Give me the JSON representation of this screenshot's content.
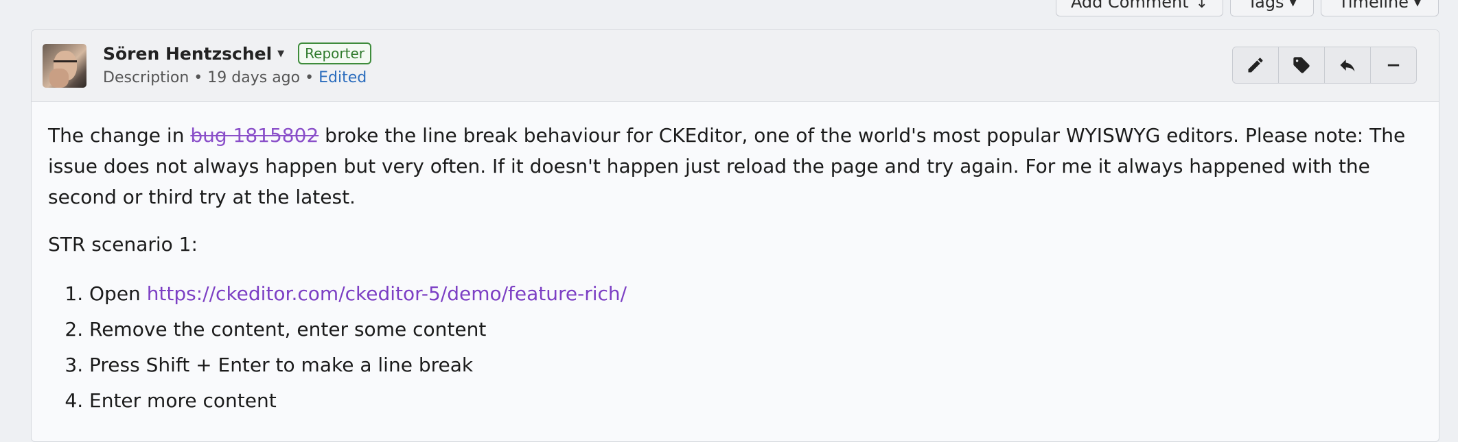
{
  "toolbar": {
    "add_comment_label": "Add Comment",
    "tags_label": "Tags",
    "timeline_label": "Timeline"
  },
  "comment": {
    "author": "Sören Hentzschel",
    "role_badge": "Reporter",
    "meta_type": "Description",
    "meta_time": "19 days ago",
    "meta_edited": "Edited",
    "actions": [
      "edit-icon",
      "tag-icon",
      "reply-icon",
      "collapse-icon"
    ],
    "body": {
      "intro_prefix": "The change in ",
      "bug_ref": "bug 1815802",
      "intro_suffix": " broke the line break behaviour for CKEditor, one of the world's most popular WYISWYG editors. Please note: The issue does not always happen but very often. If it doesn't happen just reload the page and try again. For me it always happened with the second or third try at the latest.",
      "scenario_heading": "STR scenario 1:",
      "step1_prefix": "Open ",
      "step1_url": "https://ckeditor.com/ckeditor-5/demo/feature-rich/",
      "step2": "Remove the content, enter some content",
      "step3": "Press Shift + Enter to make a line break",
      "step4": "Enter more content"
    }
  },
  "colors": {
    "link": "#7c3fc4",
    "edited": "#2a6cbd",
    "badge": "#3e8c3b"
  }
}
